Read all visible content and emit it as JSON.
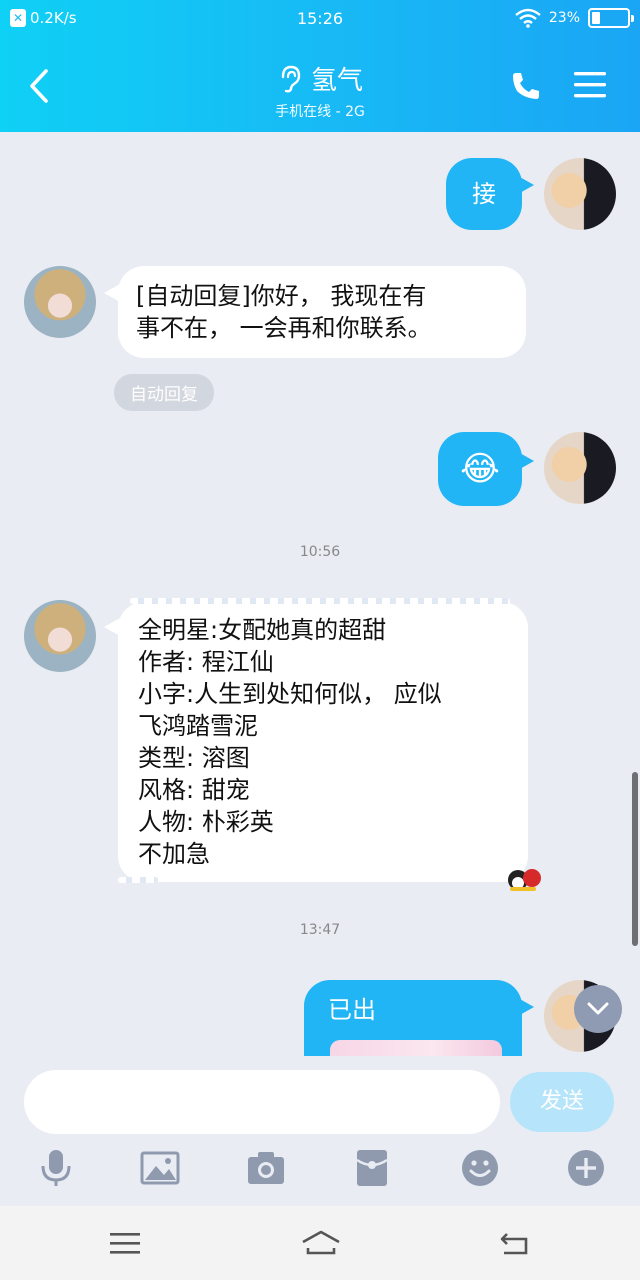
{
  "status_bar": {
    "speed": "0.2K/s",
    "time": "15:26",
    "battery": "23%",
    "battery_level": 0.23
  },
  "header": {
    "title": "氢气",
    "subtitle": "手机在线 - 2G",
    "back_icon": "chevron-left-icon",
    "call_icon": "phone-icon",
    "menu_icon": "hamburger-menu-icon"
  },
  "messages": {
    "m1": {
      "text": "接"
    },
    "m2": {
      "text_line1": "[自动回复]你好， 我现在有",
      "text_line2": "事不在， 一会再和你联系。"
    },
    "auto_reply_tag": "自动回复",
    "m3": {
      "emoji": "😂"
    },
    "time1": "10:56",
    "m4": {
      "lines": [
        "全明星:女配她真的超甜",
        "作者: 程江仙",
        "小字:人生到处知何似， 应似",
        "飞鸿踏雪泥",
        "类型: 溶图",
        "风格: 甜宠",
        "人物: 朴彩英",
        "不加急"
      ]
    },
    "time2": "13:47",
    "m5": {
      "text": "已出"
    }
  },
  "input": {
    "placeholder": "",
    "send_label": "发送"
  },
  "toolbar": {
    "icons": [
      "microphone-icon",
      "image-icon",
      "camera-icon",
      "red-packet-icon",
      "emoji-icon",
      "plus-icon"
    ]
  },
  "colors": {
    "header_start": "#0fd0f5",
    "header_end": "#1aa6f5",
    "bubble_blue": "#21b5f5",
    "chat_bg": "#e9ecf3",
    "send_disabled": "#b6e5fb"
  }
}
